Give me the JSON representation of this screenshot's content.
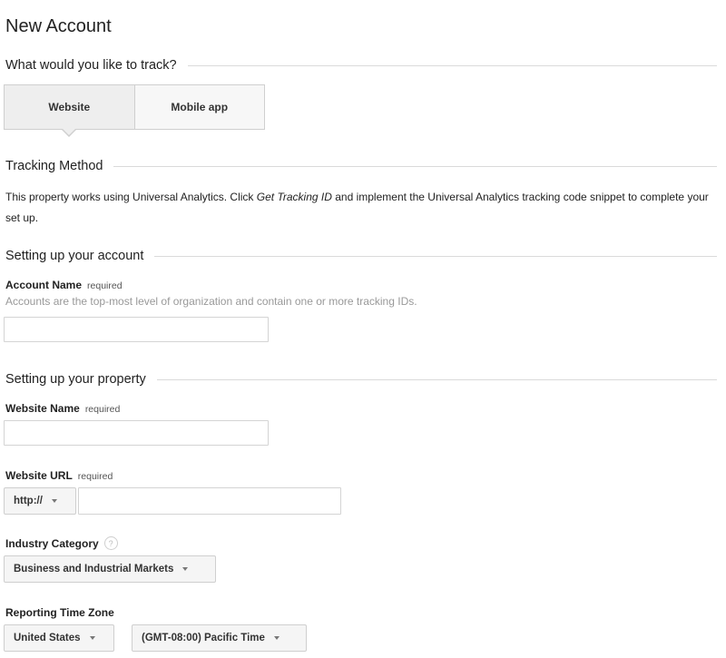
{
  "page": {
    "title": "New Account"
  },
  "track": {
    "heading": "What would you like to track?",
    "options": [
      {
        "label": "Website",
        "active": true
      },
      {
        "label": "Mobile app",
        "active": false
      }
    ]
  },
  "tracking_method": {
    "heading": "Tracking Method",
    "text_before": "This property works using Universal Analytics. Click ",
    "text_emphasis": "Get Tracking ID",
    "text_after": " and implement the Universal Analytics tracking code snippet to complete your set up."
  },
  "account": {
    "heading": "Setting up your account",
    "name_label": "Account Name",
    "required_label": "required",
    "help": "Accounts are the top-most level of organization and contain one or more tracking IDs.",
    "name_value": ""
  },
  "property": {
    "heading": "Setting up your property",
    "website_name_label": "Website Name",
    "website_name_required": "required",
    "website_name_value": "",
    "website_url_label": "Website URL",
    "website_url_required": "required",
    "protocol": "http://",
    "url_value": "",
    "industry_label": "Industry Category",
    "industry_help_icon": "?",
    "industry_value": "Business and Industrial Markets",
    "timezone_label": "Reporting Time Zone",
    "country_value": "United States",
    "timezone_value": "(GMT-08:00) Pacific Time"
  },
  "colors": {
    "active_tab_bg": "#eeeeee",
    "inactive_tab_bg": "#f7f7f7",
    "border": "#cfcfcf",
    "help_text": "#999999"
  }
}
